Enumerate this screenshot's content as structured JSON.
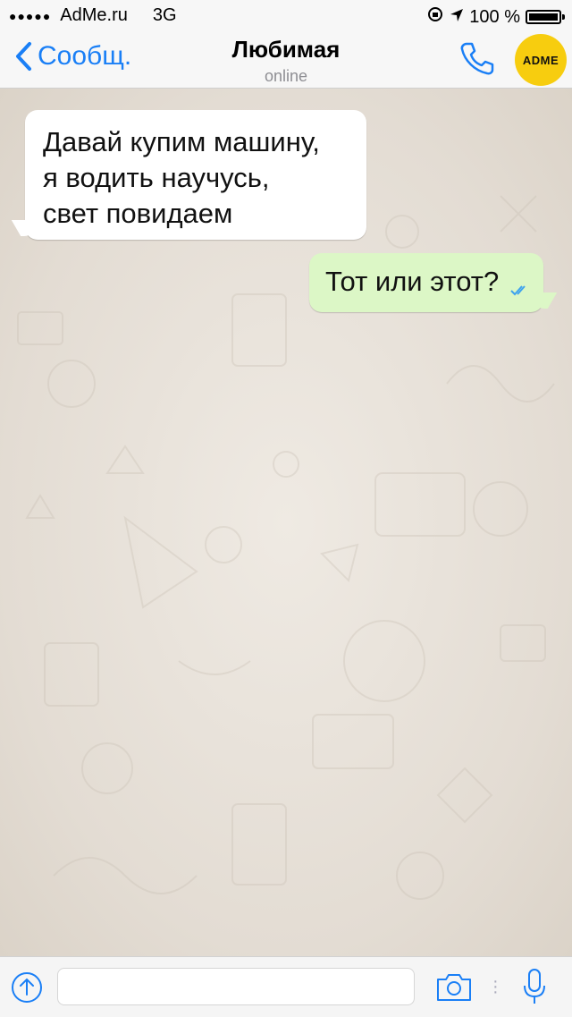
{
  "status_bar": {
    "carrier": "AdMe.ru",
    "network": "3G",
    "battery": "100 %",
    "battery_level": 1.0
  },
  "nav": {
    "back_label": "Сообщ.",
    "title": "Любимая",
    "subtitle": "online",
    "avatar_text": "ADME"
  },
  "messages": [
    {
      "direction": "incoming",
      "lines": [
        "Давай купим машину,",
        "я водить научусь,",
        "свет повидаем"
      ]
    },
    {
      "direction": "outgoing",
      "text": "Тот или этот?",
      "status_icon": "double-check-icon"
    }
  ],
  "input_bar": {
    "placeholder": ""
  },
  "colors": {
    "accent": "#1a7ff6",
    "outgoing_bubble": "#dcf7c6",
    "incoming_bubble": "#ffffff",
    "avatar_bg": "#f7cd0f"
  },
  "icons": [
    "back-chevron-icon",
    "phone-icon",
    "attach-upload-icon",
    "camera-icon",
    "microphone-icon",
    "location-arrow-icon",
    "lock-rotation-icon"
  ]
}
